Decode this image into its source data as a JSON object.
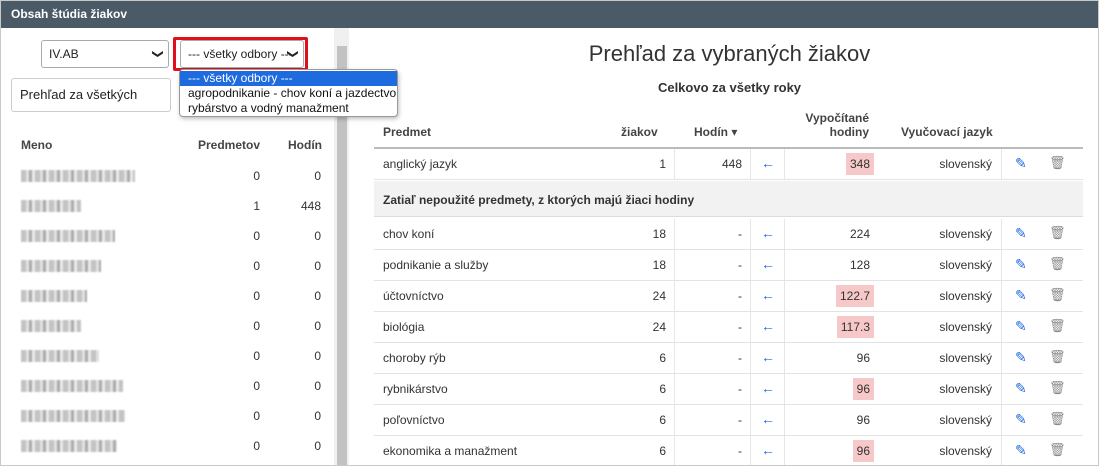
{
  "window": {
    "title": "Obsah štúdia žiakov"
  },
  "filters": {
    "class_value": "IV.AB",
    "field_value": "--- všetky odbory ---",
    "field_options": [
      "--- všetky odbory ---",
      "agropodnikanie - chov koní a jazdectvo",
      "rybárstvo a vodný manažment"
    ]
  },
  "left": {
    "overview_button": "Prehľad za všetkých",
    "columns": {
      "name": "Meno",
      "subjects": "Predmetov",
      "hours": "Hodín"
    },
    "rows": [
      {
        "subjects": "0",
        "hours": "0"
      },
      {
        "subjects": "1",
        "hours": "448"
      },
      {
        "subjects": "0",
        "hours": "0"
      },
      {
        "subjects": "0",
        "hours": "0"
      },
      {
        "subjects": "0",
        "hours": "0"
      },
      {
        "subjects": "0",
        "hours": "0"
      },
      {
        "subjects": "0",
        "hours": "0"
      },
      {
        "subjects": "0",
        "hours": "0"
      },
      {
        "subjects": "0",
        "hours": "0"
      },
      {
        "subjects": "0",
        "hours": "0"
      }
    ]
  },
  "main": {
    "title": "Prehľad za vybraných žiakov",
    "subtitle": "Celkovo za všetky roky",
    "columns": {
      "subject": "Predmet",
      "students": "žiakov",
      "hours": "Hodín",
      "sort_indicator": "▾",
      "calc_line1": "Vypočítané",
      "calc_line2": "hodiny",
      "language": "Vyučovací jazyk"
    },
    "used_rows": [
      {
        "subject": "anglický jazyk",
        "students": "1",
        "hours": "448",
        "calc": "348",
        "highlight": true,
        "language": "slovenský"
      }
    ],
    "section_label": "Zatiaľ nepoužité predmety, z ktorých majú žiaci hodiny",
    "unused_rows": [
      {
        "subject": "chov koní",
        "students": "18",
        "hours": "-",
        "calc": "224",
        "highlight": false,
        "language": "slovenský"
      },
      {
        "subject": "podnikanie a služby",
        "students": "18",
        "hours": "-",
        "calc": "128",
        "highlight": false,
        "language": "slovenský"
      },
      {
        "subject": "účtovníctvo",
        "students": "24",
        "hours": "-",
        "calc": "122.7",
        "highlight": true,
        "language": "slovenský"
      },
      {
        "subject": "biológia",
        "students": "24",
        "hours": "-",
        "calc": "117.3",
        "highlight": true,
        "language": "slovenský"
      },
      {
        "subject": "choroby rýb",
        "students": "6",
        "hours": "-",
        "calc": "96",
        "highlight": false,
        "language": "slovenský"
      },
      {
        "subject": "rybnikárstvo",
        "students": "6",
        "hours": "-",
        "calc": "96",
        "highlight": true,
        "language": "slovenský"
      },
      {
        "subject": "poľovníctvo",
        "students": "6",
        "hours": "-",
        "calc": "96",
        "highlight": false,
        "language": "slovenský"
      },
      {
        "subject": "ekonomika a manažment",
        "students": "6",
        "hours": "-",
        "calc": "96",
        "highlight": true,
        "language": "slovenský"
      }
    ],
    "icons": {
      "arrow": "←",
      "edit": "✎",
      "trash": "🗑"
    }
  },
  "colors": {
    "titlebar": "#4a5a66",
    "accent": "#1e6be0",
    "highlight": "#f7c8c8",
    "focus_box": "#e0101b"
  }
}
